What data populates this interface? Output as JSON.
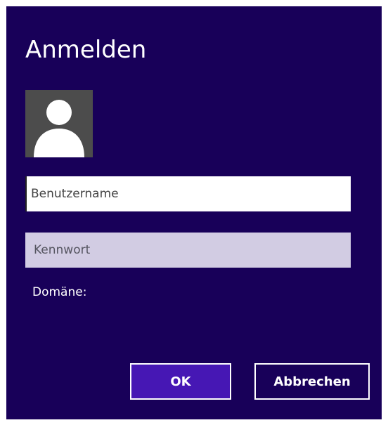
{
  "dialog": {
    "title": "Anmelden",
    "avatar_icon": "user-silhouette-icon",
    "username": {
      "value": "",
      "placeholder": "Benutzername"
    },
    "password": {
      "value": "",
      "placeholder": "Kennwort"
    },
    "domain_label": "Domäne:",
    "buttons": {
      "ok_label": "OK",
      "cancel_label": "Abbrechen"
    }
  },
  "colors": {
    "background": "#180059",
    "accent": "#4617b4",
    "password_field": "#d2cce3",
    "avatar_background": "#4c4c4c"
  }
}
